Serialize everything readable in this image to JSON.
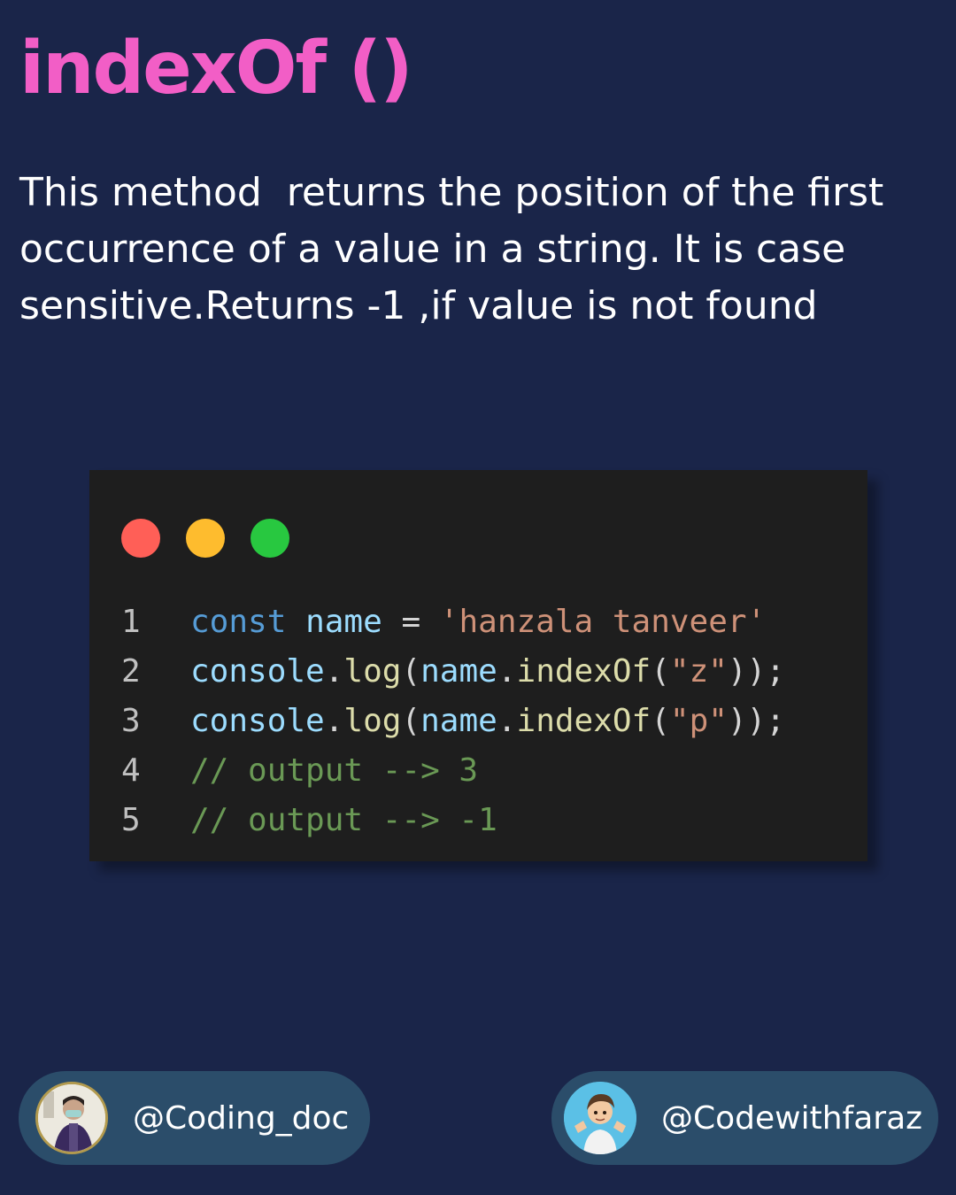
{
  "title": "indexOf ()",
  "description": "This method  returns the position of the first occurrence of a value in a string. It is case sensitive.Returns -1 ,if value is not found",
  "window_dots": [
    {
      "name": "close",
      "color": "#ff5f57"
    },
    {
      "name": "minimize",
      "color": "#febc2e"
    },
    {
      "name": "maximize",
      "color": "#28c840"
    }
  ],
  "code": {
    "line_numbers": [
      "1",
      "2",
      "3",
      "4",
      "5"
    ],
    "lines": [
      [
        {
          "t": "const",
          "k": "kw"
        },
        {
          "t": " ",
          "k": "plain"
        },
        {
          "t": "name",
          "k": "var"
        },
        {
          "t": " = ",
          "k": "plain"
        },
        {
          "t": "'hanzala tanveer'",
          "k": "str"
        }
      ],
      [
        {
          "t": "console",
          "k": "var"
        },
        {
          "t": ".",
          "k": "plain"
        },
        {
          "t": "log",
          "k": "fn"
        },
        {
          "t": "(",
          "k": "plain"
        },
        {
          "t": "name",
          "k": "var"
        },
        {
          "t": ".",
          "k": "plain"
        },
        {
          "t": "indexOf",
          "k": "fn"
        },
        {
          "t": "(",
          "k": "plain"
        },
        {
          "t": "\"z\"",
          "k": "str"
        },
        {
          "t": "));",
          "k": "plain"
        }
      ],
      [
        {
          "t": "console",
          "k": "var"
        },
        {
          "t": ".",
          "k": "plain"
        },
        {
          "t": "log",
          "k": "fn"
        },
        {
          "t": "(",
          "k": "plain"
        },
        {
          "t": "name",
          "k": "var"
        },
        {
          "t": ".",
          "k": "plain"
        },
        {
          "t": "indexOf",
          "k": "fn"
        },
        {
          "t": "(",
          "k": "plain"
        },
        {
          "t": "\"p\"",
          "k": "str"
        },
        {
          "t": "));",
          "k": "plain"
        }
      ],
      [
        {
          "t": "// output --> 3",
          "k": "comment"
        }
      ],
      [
        {
          "t": "// output --> -1",
          "k": "comment"
        }
      ]
    ]
  },
  "footer": {
    "left_handle": "@Coding_doc",
    "right_handle": "@Codewithfaraz"
  },
  "colors": {
    "background": "#1a2549",
    "title": "#f25ec6",
    "badge": "#2b4d6a"
  }
}
